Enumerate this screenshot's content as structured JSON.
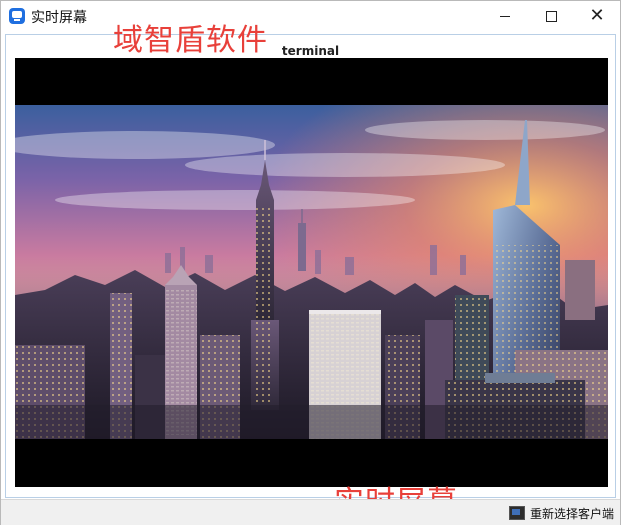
{
  "window": {
    "title": "实时屏幕",
    "icon": "teamviewer-style-app-icon",
    "controls": {
      "minimize": "minimize-icon",
      "maximize": "maximize-icon",
      "close": "close-icon",
      "close_glyph": "✕"
    }
  },
  "overlay": {
    "brand": "域智盾软件",
    "caption": "实时屏幕"
  },
  "panel": {
    "title": "terminal"
  },
  "statusbar": {
    "reselect_label": "重新选择客户端",
    "reselect_icon": "monitor-icon"
  },
  "colors": {
    "overlay_text": "#e8403a",
    "frame_border": "#b9cfe6",
    "screen_background": "#000000"
  }
}
